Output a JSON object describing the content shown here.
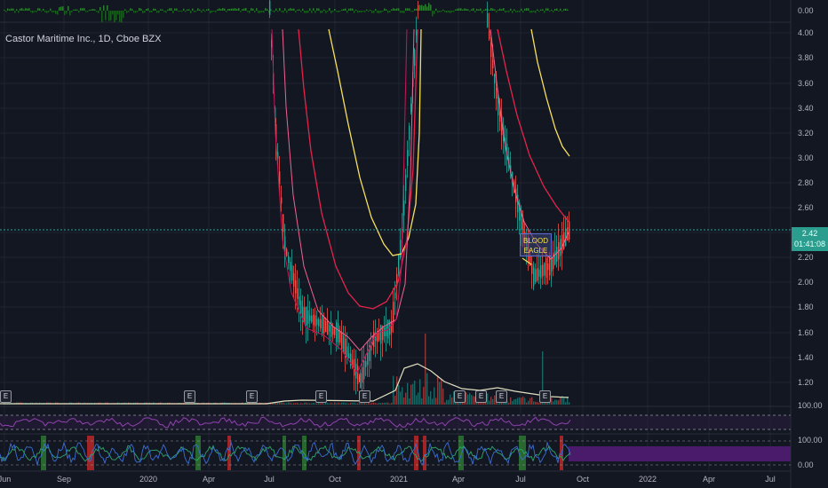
{
  "header": {
    "title": "Castor Maritime Inc., 1D, Cboe BZX"
  },
  "price_tag": {
    "price": "2.42",
    "countdown": "01:41:08"
  },
  "annotation": {
    "line1": "BLOOD",
    "line2": "EAGLE"
  },
  "earnings_badge_label": "E",
  "earnings_badges": [
    "E",
    "E",
    "E",
    "E",
    "E",
    "E",
    "E",
    "E",
    "E"
  ],
  "colors": {
    "background": "#131722",
    "up": "#26a69a",
    "down": "#ef5350",
    "ma_yellow": "#f7e05e",
    "ma_red": "#e5234a",
    "ma_pink": "#f06292",
    "volume_line": "#e0e0c0",
    "rsi_line": "#7b1fa2",
    "osc_blue": "#3b6fd4",
    "osc_green": "#2ea56d",
    "band_purple": "#4a1a6b"
  },
  "chart_data": [
    {
      "type": "line",
      "title": "Castor Maritime Inc., 1D, Cboe BZX",
      "panel": "price",
      "yscale": "log",
      "ylim": [
        1.1,
        4.0
      ],
      "yticks": [
        "4.00",
        "3.80",
        "3.60",
        "3.40",
        "3.20",
        "3.00",
        "2.80",
        "2.60",
        "2.40",
        "2.20",
        "2.00",
        "1.80",
        "1.60",
        "1.40",
        "1.20"
      ],
      "x_ticks": [
        "Jun",
        "Sep",
        "2020",
        "Apr",
        "Jul",
        "Oct",
        "2021",
        "Apr",
        "Jul",
        "Oct",
        "2022",
        "Apr",
        "Jul"
      ],
      "series": [
        {
          "x": [
            "2020-07",
            "2020-08",
            "2020-09",
            "2020-10",
            "2020-11",
            "2020-12",
            "2021-01",
            "2021-02"
          ],
          "values": [
            4.0,
            2.6,
            1.9,
            1.6,
            1.4,
            1.7,
            2.1,
            4.0
          ]
        },
        {
          "x": [
            "2021-05",
            "2021-06",
            "2021-07",
            "2021-08",
            "2021-09"
          ],
          "values": [
            4.0,
            3.0,
            2.5,
            2.1,
            2.42
          ]
        }
      ],
      "last_price": 2.42
    },
    {
      "type": "bar",
      "panel": "top-histogram",
      "yticks": [
        "0.00"
      ]
    },
    {
      "type": "line",
      "panel": "rsi",
      "yticks": [
        "100.00"
      ]
    },
    {
      "type": "line",
      "panel": "oscillator",
      "yticks": [
        "100.00",
        "0.00"
      ]
    }
  ]
}
